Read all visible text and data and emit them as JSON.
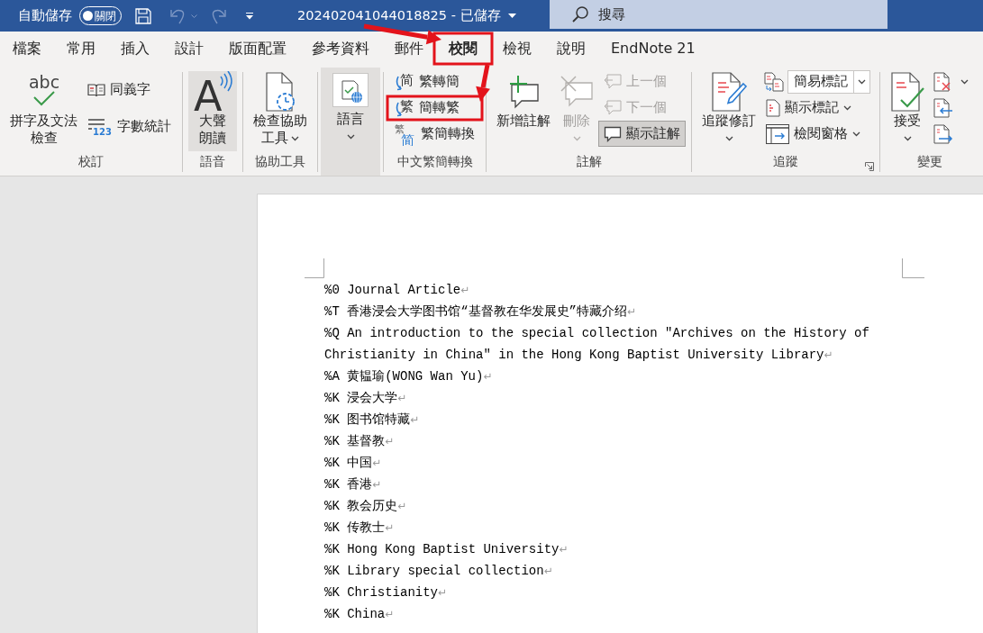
{
  "title_bar": {
    "autosave": {
      "label": "自動儲存",
      "toggle_text": "關閉",
      "on": false
    },
    "quick_access": [
      {
        "kind": "save",
        "disabled": false,
        "dropdown": false
      },
      {
        "kind": "undo",
        "disabled": true,
        "dropdown": true
      },
      {
        "kind": "redo",
        "disabled": true,
        "dropdown": false
      },
      {
        "kind": "customize",
        "disabled": false,
        "dropdown": false
      }
    ],
    "document_title": "202402041044018825 - 已儲存",
    "search": {
      "placeholder": "搜尋"
    }
  },
  "tabs": [
    {
      "label": "檔案",
      "selected": false,
      "callout": false
    },
    {
      "label": "常用",
      "selected": false,
      "callout": false
    },
    {
      "label": "插入",
      "selected": false,
      "callout": false
    },
    {
      "label": "設計",
      "selected": false,
      "callout": false
    },
    {
      "label": "版面配置",
      "selected": false,
      "callout": false
    },
    {
      "label": "參考資料",
      "selected": false,
      "callout": false
    },
    {
      "label": "郵件",
      "selected": false,
      "callout": false
    },
    {
      "label": "校閱",
      "selected": true,
      "callout": true
    },
    {
      "label": "檢視",
      "selected": false,
      "callout": false
    },
    {
      "label": "說明",
      "selected": false,
      "callout": false
    },
    {
      "label": "EndNote 21",
      "selected": false,
      "callout": false
    }
  ],
  "ribbon": {
    "groups": [
      {
        "label": "校訂",
        "launcher": false,
        "buttons": [
          {
            "kind": "large",
            "lines": [
              "拼字及文法",
              "檢查"
            ],
            "icon_text": [
              "abc"
            ],
            "disabled": false,
            "highlighted": false,
            "dropdown": false,
            "callout": false
          },
          {
            "kind": "small",
            "label": "同義字",
            "disabled": false,
            "highlighted": false,
            "dropdown": false,
            "callout": false
          },
          {
            "kind": "small",
            "label": "字數統計",
            "icon_text": [
              "123"
            ],
            "disabled": false,
            "highlighted": false,
            "dropdown": false,
            "callout": false
          }
        ]
      },
      {
        "label": "語音",
        "launcher": false,
        "buttons": [
          {
            "kind": "large",
            "lines": [
              "大聲",
              "朗讀"
            ],
            "icon_text": [
              "A"
            ],
            "disabled": false,
            "highlighted": true,
            "dropdown": false,
            "callout": false
          }
        ]
      },
      {
        "label": "協助工具",
        "launcher": false,
        "buttons": [
          {
            "kind": "large",
            "lines": [
              "檢查協助",
              "工具"
            ],
            "disabled": false,
            "highlighted": false,
            "dropdown": true,
            "callout": false
          }
        ]
      },
      {
        "launcher": false,
        "buttons": [
          {
            "kind": "large",
            "lines": [
              "語言"
            ],
            "disabled": false,
            "highlighted": true,
            "dropdown": true,
            "callout": false
          }
        ]
      },
      {
        "label": "中文繁簡轉換",
        "launcher": false,
        "buttons": [
          {
            "kind": "small",
            "label": "繁轉簡",
            "icon_text": [
              "简"
            ],
            "disabled": false,
            "highlighted": false,
            "dropdown": false,
            "callout": false
          },
          {
            "kind": "small",
            "label": "簡轉繁",
            "icon_text": [
              "繁"
            ],
            "disabled": false,
            "highlighted": false,
            "dropdown": false,
            "callout": true
          },
          {
            "kind": "small",
            "label": "繁簡轉換",
            "icon_text": [
              "繁",
              "简"
            ],
            "disabled": false,
            "highlighted": false,
            "dropdown": false,
            "callout": false
          }
        ]
      },
      {
        "label": "註解",
        "launcher": false,
        "buttons": [
          {
            "kind": "large",
            "lines": [
              "新增註解"
            ],
            "disabled": false,
            "highlighted": false,
            "dropdown": false,
            "callout": false
          },
          {
            "kind": "large",
            "lines": [
              "刪除"
            ],
            "disabled": true,
            "highlighted": false,
            "dropdown": true,
            "callout": false
          },
          {
            "kind": "small",
            "label": "上一個",
            "disabled": true,
            "highlighted": false,
            "dropdown": false,
            "callout": false
          },
          {
            "kind": "small",
            "label": "下一個",
            "disabled": true,
            "highlighted": false,
            "dropdown": false,
            "callout": false
          },
          {
            "kind": "small",
            "label": "顯示註解",
            "disabled": false,
            "highlighted": true,
            "dropdown": false,
            "callout": false
          }
        ]
      },
      {
        "label": "追蹤",
        "launcher": true,
        "buttons": [
          {
            "kind": "large",
            "lines": [
              "追蹤修訂"
            ],
            "disabled": false,
            "highlighted": false,
            "dropdown": true,
            "callout": false
          },
          {
            "kind": "select",
            "value": "簡易標記",
            "disabled": false,
            "highlighted": false,
            "dropdown": true,
            "callout": false
          },
          {
            "kind": "small",
            "label": "顯示標記",
            "disabled": false,
            "highlighted": false,
            "dropdown": true,
            "callout": false
          },
          {
            "kind": "small",
            "label": "檢閱窗格",
            "disabled": false,
            "highlighted": false,
            "dropdown": true,
            "callout": false
          }
        ]
      },
      {
        "label": "變更",
        "launcher": false,
        "buttons": [
          {
            "kind": "large",
            "lines": [
              "接受"
            ],
            "disabled": false,
            "highlighted": false,
            "dropdown": true,
            "callout": false
          },
          {
            "kind": "icon",
            "disabled": false,
            "highlighted": false,
            "dropdown": true,
            "callout": false
          },
          {
            "kind": "icon",
            "disabled": false,
            "highlighted": false,
            "dropdown": false,
            "callout": false
          },
          {
            "kind": "icon",
            "disabled": false,
            "highlighted": false,
            "dropdown": false,
            "callout": false
          }
        ]
      }
    ]
  },
  "document": {
    "paragraphs": [
      {
        "text": "%0 Journal Article",
        "end_mark": "↵"
      },
      {
        "text": "%T 香港浸会大学图书馆“基督教在华发展史”特藏介绍",
        "end_mark": "↵"
      },
      {
        "text": "%Q An introduction to the special collection \"Archives on the History of Christianity in China\" in the Hong Kong Baptist University Library",
        "end_mark": "↵"
      },
      {
        "text": "%A 黄韫瑜(WONG Wan Yu)",
        "end_mark": "↵"
      },
      {
        "text": "%K 浸会大学",
        "end_mark": "↵"
      },
      {
        "text": "%K 图书馆特藏",
        "end_mark": "↵"
      },
      {
        "text": "%K 基督教",
        "end_mark": "↵"
      },
      {
        "text": "%K 中国",
        "end_mark": "↵"
      },
      {
        "text": "%K 香港",
        "end_mark": "↵"
      },
      {
        "text": "%K 教会历史",
        "end_mark": "↵"
      },
      {
        "text": "%K 传教士",
        "end_mark": "↵"
      },
      {
        "text": "%K Hong Kong Baptist University",
        "end_mark": "↵"
      },
      {
        "text": "%K Library special collection",
        "end_mark": "↵"
      },
      {
        "text": "%K Christianity",
        "end_mark": "↵"
      },
      {
        "text": "%K China",
        "end_mark": "↵"
      }
    ]
  }
}
